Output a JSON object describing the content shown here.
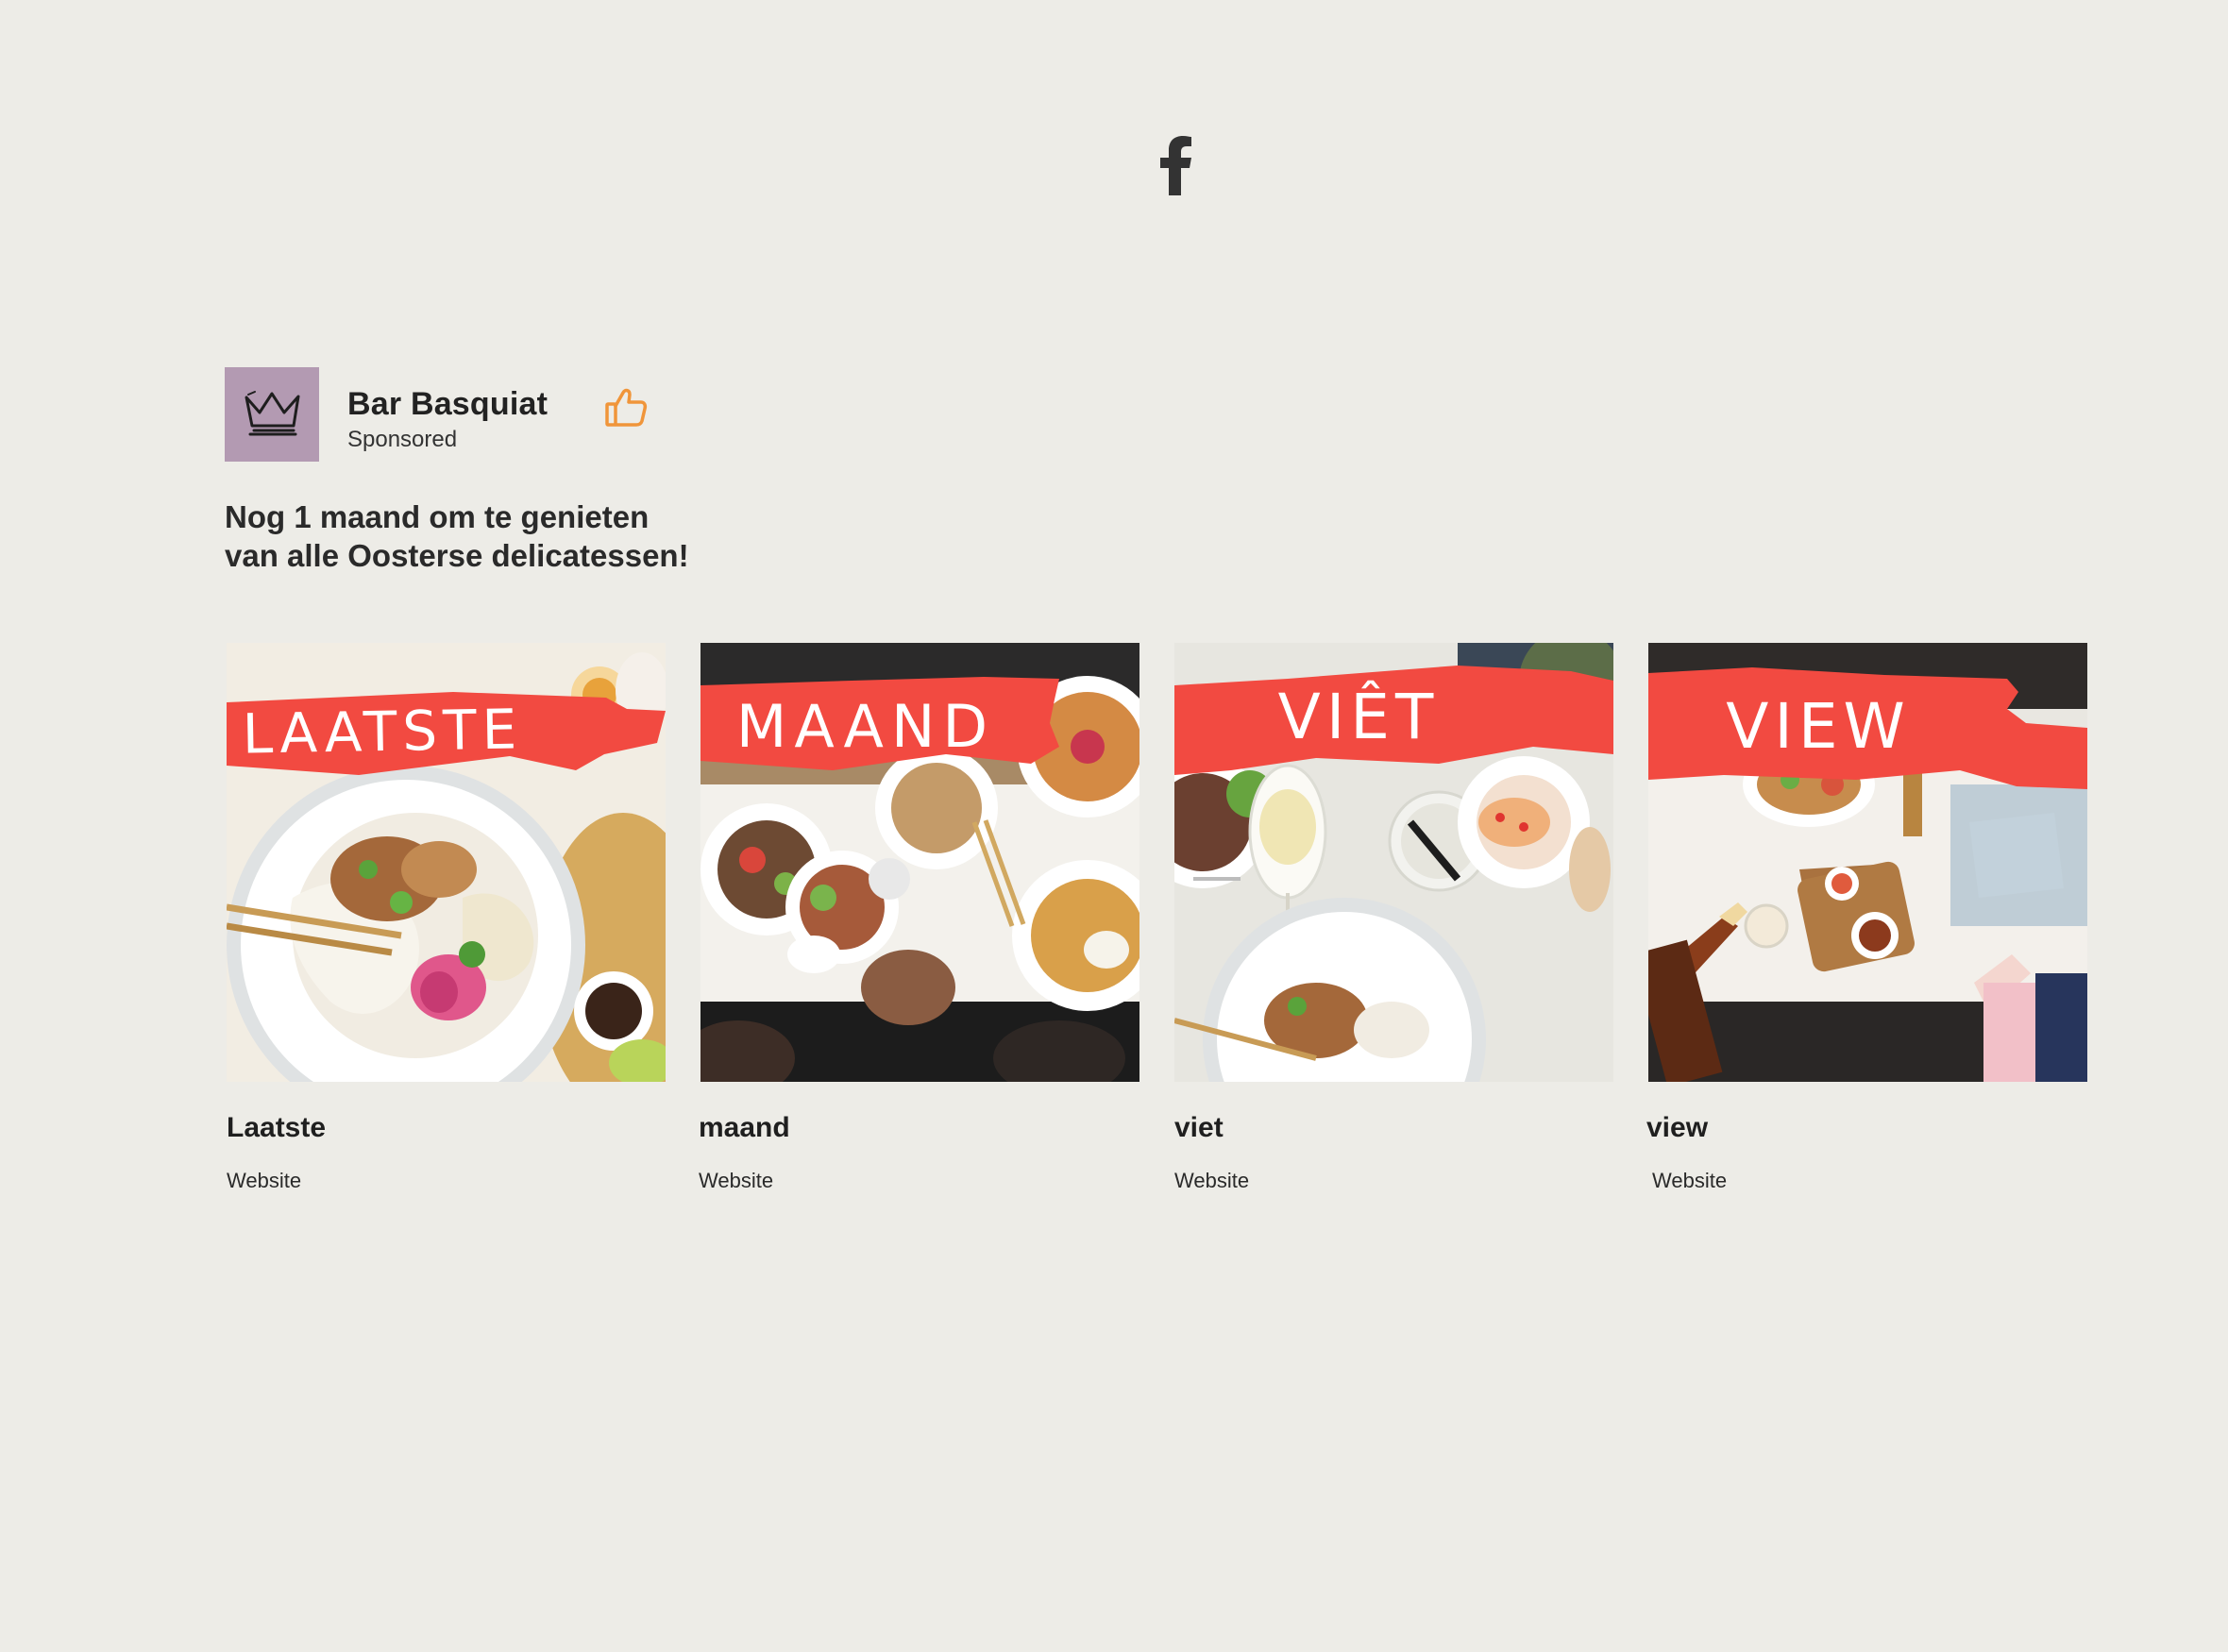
{
  "icons": {
    "top_logo": "facebook-f-icon",
    "like": "thumbs-up-icon",
    "avatar": "crown-icon"
  },
  "colors": {
    "background": "#edece7",
    "avatar_bg": "#b39ab2",
    "like_orange": "#f0953a",
    "brush_red": "#f24a41"
  },
  "post": {
    "page_name": "Bar Basquiat",
    "sponsored_label": "Sponsored",
    "text": "Nog 1 maand om te genieten van alle Oosterse delicatessen!"
  },
  "cards": [
    {
      "overlay_text": "LAATSTE",
      "title": "Laatste",
      "subtitle": "Website"
    },
    {
      "overlay_text": "MAAND",
      "title": "maand",
      "subtitle": "Website"
    },
    {
      "overlay_text": "VIÊT",
      "title": "viet",
      "subtitle": "Website"
    },
    {
      "overlay_text": "VIEW",
      "title": "view",
      "subtitle": "Website"
    }
  ]
}
